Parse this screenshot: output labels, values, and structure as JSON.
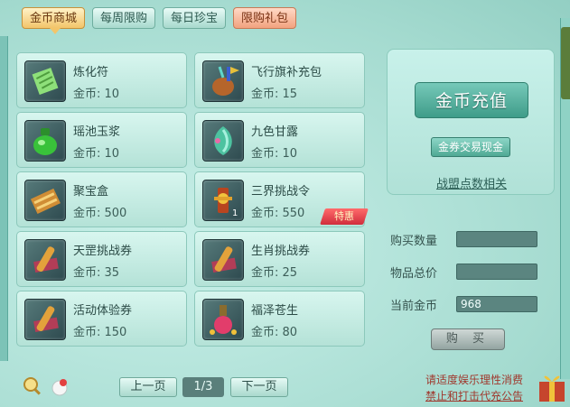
{
  "tabs": [
    {
      "label": "金币商城",
      "active": true
    },
    {
      "label": "每周限购",
      "active": false
    },
    {
      "label": "每日珍宝",
      "active": false
    },
    {
      "label": "限购礼包",
      "active": false
    }
  ],
  "items": [
    {
      "name": "炼化符",
      "price": "金币: 10",
      "icon": "talisman-icon"
    },
    {
      "name": "飞行旗补充包",
      "price": "金币: 15",
      "icon": "flag-bag-icon"
    },
    {
      "name": "瑶池玉浆",
      "price": "金币: 10",
      "icon": "jade-jar-icon"
    },
    {
      "name": "九色甘露",
      "price": "金币: 10",
      "icon": "nectar-icon"
    },
    {
      "name": "聚宝盒",
      "price": "金币: 500",
      "icon": "treasure-box-icon"
    },
    {
      "name": "三界挑战令",
      "price": "金币: 550",
      "icon": "challenge-token-icon",
      "qty": "1",
      "badge": "特惠"
    },
    {
      "name": "天罡挑战券",
      "price": "金币: 35",
      "icon": "scroll-icon"
    },
    {
      "name": "生肖挑战券",
      "price": "金币: 25",
      "icon": "scroll-icon"
    },
    {
      "name": "活动体验券",
      "price": "金币: 150",
      "icon": "scroll-icon"
    },
    {
      "name": "福泽苍生",
      "price": "金币: 80",
      "icon": "potion-bottle-icon"
    }
  ],
  "panel": {
    "recharge": "金币充值",
    "exchange": "金券交易现金",
    "alliance": "战盟点数相关"
  },
  "purchase": {
    "qty_label": "购买数量",
    "total_label": "物品总价",
    "current_label": "当前金币",
    "qty_value": "",
    "total_value": "",
    "current_value": "968",
    "buy_label": "购 买"
  },
  "pagination": {
    "prev": "上一页",
    "indicator": "1/3",
    "next": "下一页"
  },
  "notice": {
    "line1": "请适度娱乐理性消费",
    "line2": "禁止和打击代充公告"
  }
}
